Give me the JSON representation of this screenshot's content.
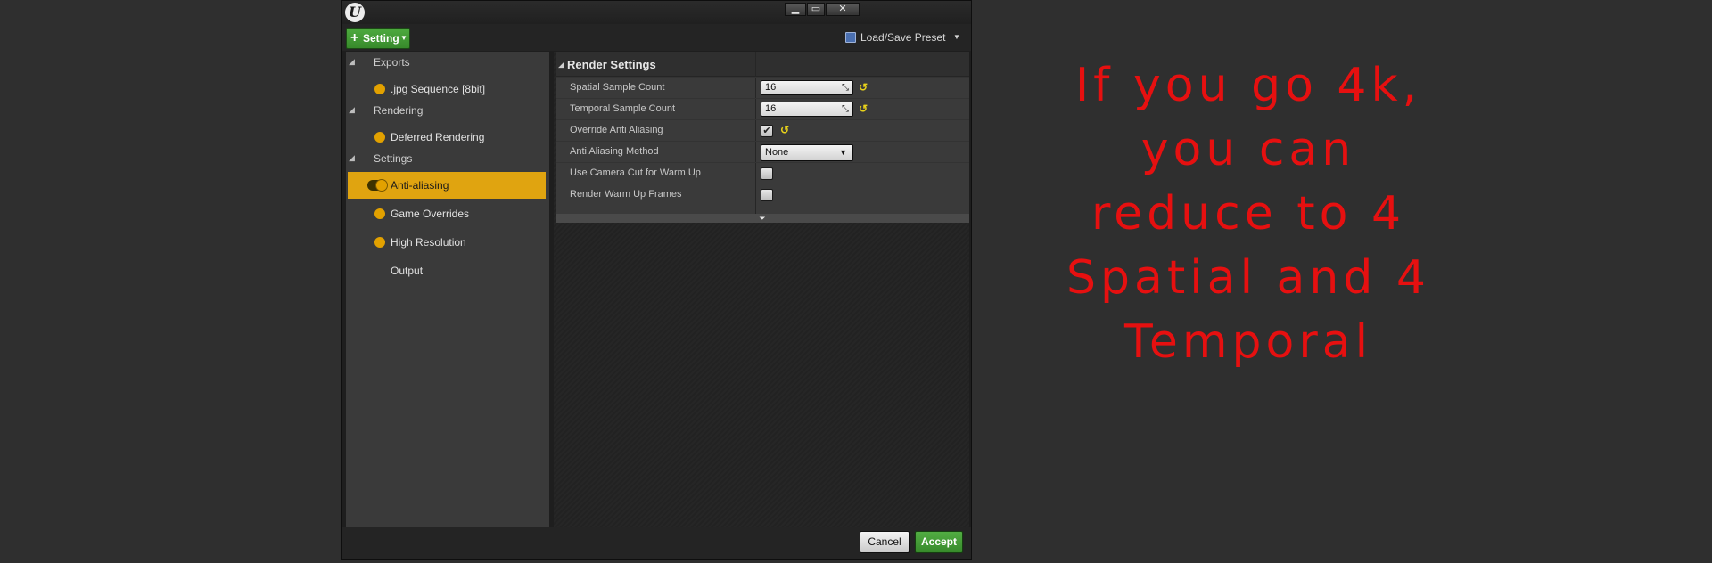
{
  "window": {
    "logo": "U",
    "controls": {
      "minimize": "▁",
      "maximize": "▭",
      "close": "✕"
    }
  },
  "toolbar": {
    "setting_icon": "+",
    "setting_label": "Setting",
    "preset_label": "Load/Save Preset"
  },
  "sidebar": {
    "sections": [
      {
        "label": "Exports",
        "items": [
          {
            "label": ".jpg Sequence [8bit]"
          }
        ]
      },
      {
        "label": "Rendering",
        "items": [
          {
            "label": "Deferred Rendering"
          }
        ]
      },
      {
        "label": "Settings",
        "items": [
          {
            "label": "Anti-aliasing",
            "active": true
          },
          {
            "label": "Game Overrides"
          },
          {
            "label": "High Resolution"
          },
          {
            "label": "Output"
          }
        ]
      }
    ]
  },
  "details": {
    "category": "Render Settings",
    "rows": [
      {
        "label": "Spatial Sample Count",
        "value": "16"
      },
      {
        "label": "Temporal Sample Count",
        "value": "16"
      },
      {
        "label": "Override Anti Aliasing",
        "checked": true
      },
      {
        "label": "Anti Aliasing Method",
        "value": "None"
      },
      {
        "label": "Use Camera Cut for Warm Up",
        "checked": false
      },
      {
        "label": "Render Warm Up Frames",
        "checked": false
      }
    ]
  },
  "footer": {
    "cancel_label": "Cancel",
    "accept_label": "Accept"
  },
  "annotation": {
    "lines": [
      "If you go 4k,",
      "you can",
      "reduce to 4",
      "Spatial and 4",
      "Temporal"
    ],
    "color": "#e61010"
  },
  "colors": {
    "accent_green": "#4caf3e",
    "selection_orange": "#e0a410",
    "reset_yellow": "#e8d21a",
    "background": "#2f2f2f"
  }
}
